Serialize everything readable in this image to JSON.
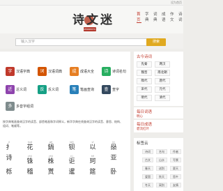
{
  "topbar": {
    "right_text": "设为首页"
  },
  "logo": {
    "text": "诗文迷",
    "seal": "shiwenmi.com"
  },
  "nav": [
    "首页",
    "字典",
    "词典",
    "成语",
    "作文",
    "诗词"
  ],
  "search": {
    "placeholder": "输入汉字",
    "button": "搜索"
  },
  "tools": [
    {
      "label": "汉语字典",
      "sub": "",
      "color": "#c0392b"
    },
    {
      "label": "汉语词典",
      "sub": "",
      "color": "#d35400"
    },
    {
      "label": "成语大全",
      "sub": "",
      "color": "#e67e22"
    },
    {
      "label": "诗词名句",
      "sub": "",
      "color": "#27ae60"
    },
    {
      "label": "近义词",
      "sub": "",
      "color": "#8e44ad"
    },
    {
      "label": "反义词",
      "sub": "",
      "color": "#16a085"
    },
    {
      "label": "笔画查询",
      "sub": "",
      "color": "#2980b9"
    },
    {
      "label": "查字",
      "sub": "",
      "color": "#34495e"
    },
    {
      "label": "多音字组词",
      "sub": "",
      "color": "#7f8c8d"
    }
  ],
  "description": "按字典笔画查询汉字的读音、部首笔画和字词释义，新华字典在线查询汉字的读音、意思、结构、组词、笔顺等。",
  "chars": [
    {
      "py": "jǐ",
      "zi": "扌"
    },
    {
      "py": "huā",
      "zi": "花"
    },
    {
      "py": "gē",
      "zi": "鍋"
    },
    {
      "py": "bèi",
      "zi": "钡"
    },
    {
      "py": "yǐ",
      "zi": "以"
    },
    {
      "py": "bì",
      "zi": "赑"
    },
    {
      "py": "",
      "zi": "诗"
    },
    {
      "py": "zhū",
      "zi": "铢"
    },
    {
      "py": "zhū",
      "zi": "株"
    },
    {
      "py": "jù",
      "zi": "讵"
    },
    {
      "py": "kē",
      "zi": "珂"
    },
    {
      "py": "",
      "zi": "亚"
    },
    {
      "py": "",
      "zi": "栎"
    },
    {
      "py": "",
      "zi": "稽"
    },
    {
      "py": "",
      "zi": "贳"
    },
    {
      "py": "",
      "zi": "暹"
    },
    {
      "py": "",
      "zi": "筵"
    },
    {
      "py": "",
      "zi": "卧"
    }
  ],
  "side": {
    "dynasty_title": "古今诗词",
    "dynasties": [
      "先秦",
      "两汉",
      "魏晋",
      "南北朝",
      "隋代",
      "唐代",
      "宋代",
      "元代",
      "明代",
      "清代",
      "近代",
      "现代"
    ],
    "daily_word_title": "每日词语",
    "daily_word": "明心",
    "daily_idiom_title": "每日成语",
    "daily_idiom": "碧流红叶",
    "tag_title": "标签云",
    "tags": [
      "诗词",
      "名句",
      "作者",
      "古文",
      "山水",
      "写景",
      "春天",
      "送别",
      "夏天",
      "爱国",
      "秋天",
      "思乡",
      "冬天",
      "离别",
      "友情"
    ]
  }
}
